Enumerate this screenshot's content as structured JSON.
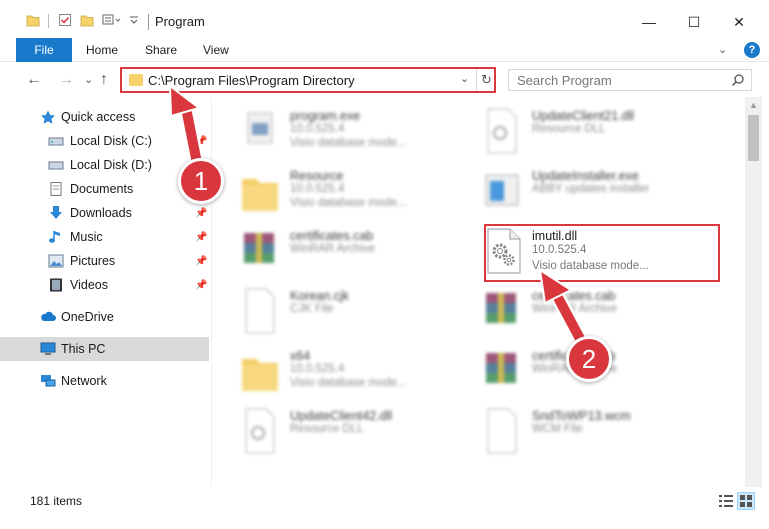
{
  "window": {
    "title": "Program",
    "minimize": "—",
    "maximize": "☐",
    "close": "✕"
  },
  "ribbon": {
    "tabs": [
      "File",
      "Home",
      "Share",
      "View"
    ],
    "help": "?",
    "collapse": "⌄"
  },
  "nav": {
    "address": "C:\\Program Files\\Program Directory",
    "search_placeholder": "Search Program",
    "back": "←",
    "forward": "→",
    "recent": "⌄",
    "up": "↑",
    "dropdown": "⌄",
    "refresh": "↻",
    "search_glyph": "⚲"
  },
  "sidebar": {
    "items": [
      {
        "label": "Quick access",
        "icon": "star-icon",
        "pinned": false
      },
      {
        "label": "Local Disk (C:)",
        "icon": "drive-icon",
        "pinned": true
      },
      {
        "label": "Local Disk (D:)",
        "icon": "drive-icon",
        "pinned": false
      },
      {
        "label": "Documents",
        "icon": "documents-icon",
        "pinned": true
      },
      {
        "label": "Downloads",
        "icon": "download-icon",
        "pinned": true
      },
      {
        "label": "Music",
        "icon": "music-icon",
        "pinned": true
      },
      {
        "label": "Pictures",
        "icon": "pictures-icon",
        "pinned": true
      },
      {
        "label": "Videos",
        "icon": "videos-icon",
        "pinned": true
      },
      {
        "label": "OneDrive",
        "icon": "cloud-icon",
        "pinned": false
      },
      {
        "label": "This PC",
        "icon": "computer-icon",
        "pinned": false,
        "selected": true
      },
      {
        "label": "Network",
        "icon": "network-icon",
        "pinned": false
      }
    ]
  },
  "files": [
    {
      "name": "program.exe",
      "line2": "10.0.525.4",
      "line3": "Visio database mode...",
      "icon": "exe-icon"
    },
    {
      "name": "UpdateClient21.dll",
      "line2": "Resource DLL",
      "line3": "",
      "icon": "dll-icon"
    },
    {
      "name": "Resource",
      "line2": "10.0.525.4",
      "line3": "Visio database mode...",
      "icon": "folder-icon"
    },
    {
      "name": "UpdateInstaller.exe",
      "line2": "ABBY updates installer",
      "line3": "",
      "icon": "installer-icon"
    },
    {
      "name": "certificates.cab",
      "line2": "WinRAR Archive",
      "line3": "",
      "icon": "archive-icon"
    },
    {
      "name": "imutil.dll",
      "line2": "10.0.525.4",
      "line3": "Visio database mode...",
      "icon": "dll-gears-icon"
    },
    {
      "name": "Korean.cjk",
      "line2": "CJK File",
      "line3": "",
      "icon": "file-icon"
    },
    {
      "name": "certificates.cab",
      "line2": "WinRAR Archive",
      "line3": "",
      "icon": "archive-icon"
    },
    {
      "name": "x64",
      "line2": "10.0.525.4",
      "line3": "Visio database mode...",
      "icon": "folder-icon"
    },
    {
      "name": "certificates.cab",
      "line2": "WinRAR Archive",
      "line3": "",
      "icon": "archive-icon"
    },
    {
      "name": "UpdateClient42.dll",
      "line2": "Resource DLL",
      "line3": "",
      "icon": "dll-icon"
    },
    {
      "name": "SndToWP13.wcm",
      "line2": "WCM File",
      "line3": "",
      "icon": "file-icon"
    }
  ],
  "status": {
    "items_count": "181 items"
  },
  "annotations": {
    "step1": "1",
    "step2": "2"
  },
  "colors": {
    "accent": "#1979ca",
    "annotation_red": "#d9373d",
    "folder_yellow": "#f7d26a"
  }
}
